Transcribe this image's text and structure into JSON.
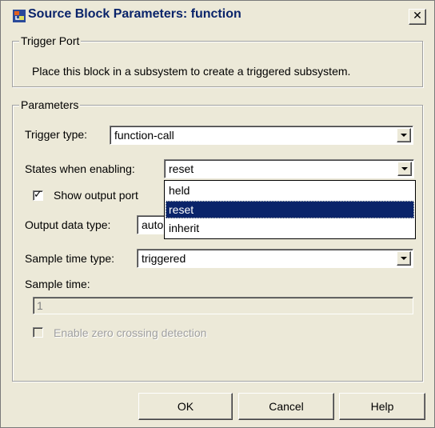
{
  "window": {
    "title": "Source Block Parameters: function",
    "close_glyph": "✕",
    "icon": "simulink-block-icon"
  },
  "trigger_port": {
    "legend": "Trigger Port",
    "description": "Place this block in a subsystem to create a triggered subsystem."
  },
  "parameters": {
    "legend": "Parameters",
    "trigger_type": {
      "label": "Trigger type:",
      "value": "function-call"
    },
    "states_when_enabling": {
      "label": "States when enabling:",
      "value": "reset",
      "options": [
        "held",
        "reset",
        "inherit"
      ],
      "highlighted": "reset"
    },
    "show_output_port": {
      "label": "Show output port",
      "checked": true
    },
    "output_data_type": {
      "label": "Output data type:",
      "value": "auto"
    },
    "sample_time_type": {
      "label": "Sample time type:",
      "value": "triggered"
    },
    "sample_time": {
      "label": "Sample time:",
      "value": "1"
    },
    "enable_zero_crossing": {
      "label": "Enable zero crossing detection",
      "checked": false,
      "disabled": true
    }
  },
  "buttons": {
    "ok": "OK",
    "cancel": "Cancel",
    "help": "Help"
  },
  "colors": {
    "face": "#ece9d8",
    "title_text": "#0a246a",
    "selection": "#0a246a"
  }
}
